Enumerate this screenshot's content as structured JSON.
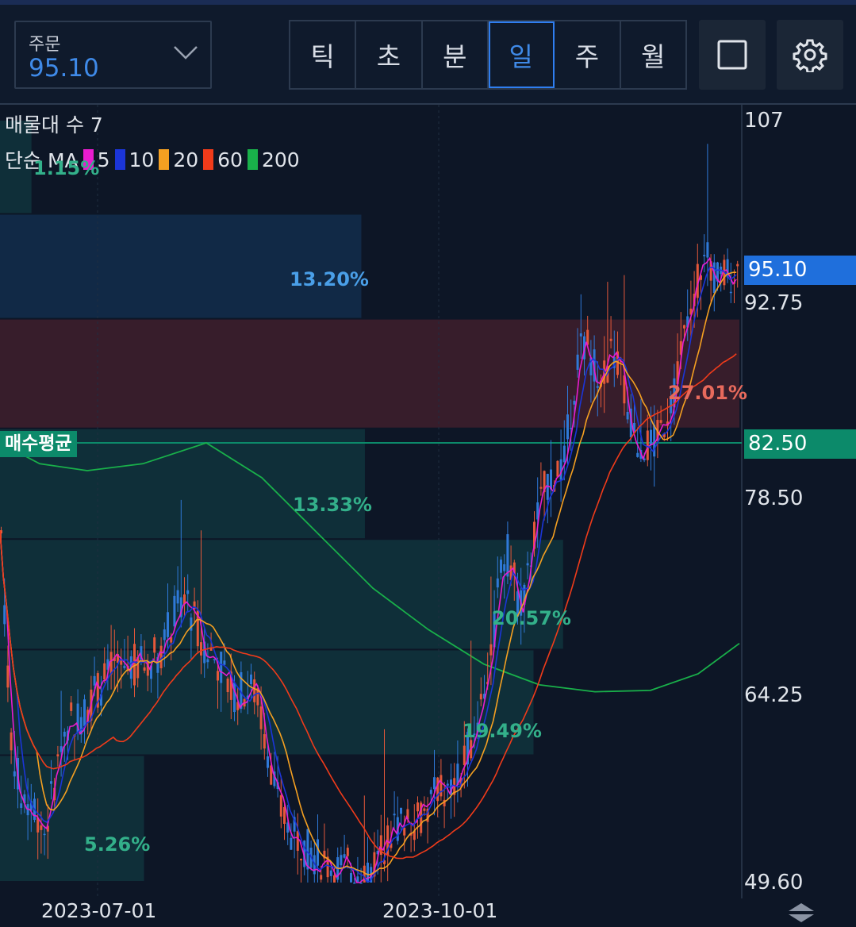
{
  "toolbar": {
    "order_label": "주문",
    "order_value": "95.10",
    "periods": [
      {
        "label": "틱",
        "active": false
      },
      {
        "label": "초",
        "active": false
      },
      {
        "label": "분",
        "active": false
      },
      {
        "label": "일",
        "active": true
      },
      {
        "label": "주",
        "active": false
      },
      {
        "label": "월",
        "active": false
      }
    ],
    "square_icon": "square-icon",
    "settings_icon": "gear-icon"
  },
  "legend": {
    "volume_profile": "매물대 수 7",
    "ma_label": "단순 MA",
    "ma_items": [
      {
        "period": "5",
        "color": "#e81ccf"
      },
      {
        "period": "10",
        "color": "#1b35d8"
      },
      {
        "period": "20",
        "color": "#f5a021"
      },
      {
        "period": "60",
        "color": "#f03b1a"
      },
      {
        "period": "200",
        "color": "#19b04a"
      }
    ]
  },
  "price_axis": {
    "labels": [
      "107",
      "92.75",
      "78.50",
      "64.25",
      "49.60"
    ],
    "current_price": "95.10",
    "average_price": "82.50"
  },
  "avg_line_label": "매수평균",
  "volume_profile_pcts": [
    "1.15%",
    "13.20%",
    "27.01%",
    "13.33%",
    "20.57%",
    "19.49%",
    "5.26%"
  ],
  "date_axis": [
    "2023-07-01",
    "2023-10-01"
  ],
  "colors": {
    "up": "#e5583a",
    "down": "#2f79d8",
    "accent": "#3f8ae8",
    "avg_green": "#0c8a6a"
  },
  "chart_data": {
    "type": "candlestick",
    "price_range": [
      49.6,
      107
    ],
    "current_price": 95.1,
    "average_price": 82.5,
    "volume_profile": [
      {
        "range": [
          99.5,
          107
        ],
        "pct": 1.15
      },
      {
        "range": [
          91.5,
          99.5
        ],
        "pct": 13.2
      },
      {
        "range": [
          83.5,
          91.5
        ],
        "pct": 27.01
      },
      {
        "range": [
          75.5,
          83.5
        ],
        "pct": 13.33
      },
      {
        "range": [
          67.5,
          75.5
        ],
        "pct": 20.57
      },
      {
        "range": [
          59.5,
          67.5
        ],
        "pct": 19.49
      },
      {
        "range": [
          49.6,
          59.5
        ],
        "pct": 5.26
      }
    ],
    "moving_averages": [
      "5",
      "10",
      "20",
      "60",
      "200"
    ],
    "x_labels": [
      "2023-07-01",
      "2023-10-01"
    ]
  }
}
